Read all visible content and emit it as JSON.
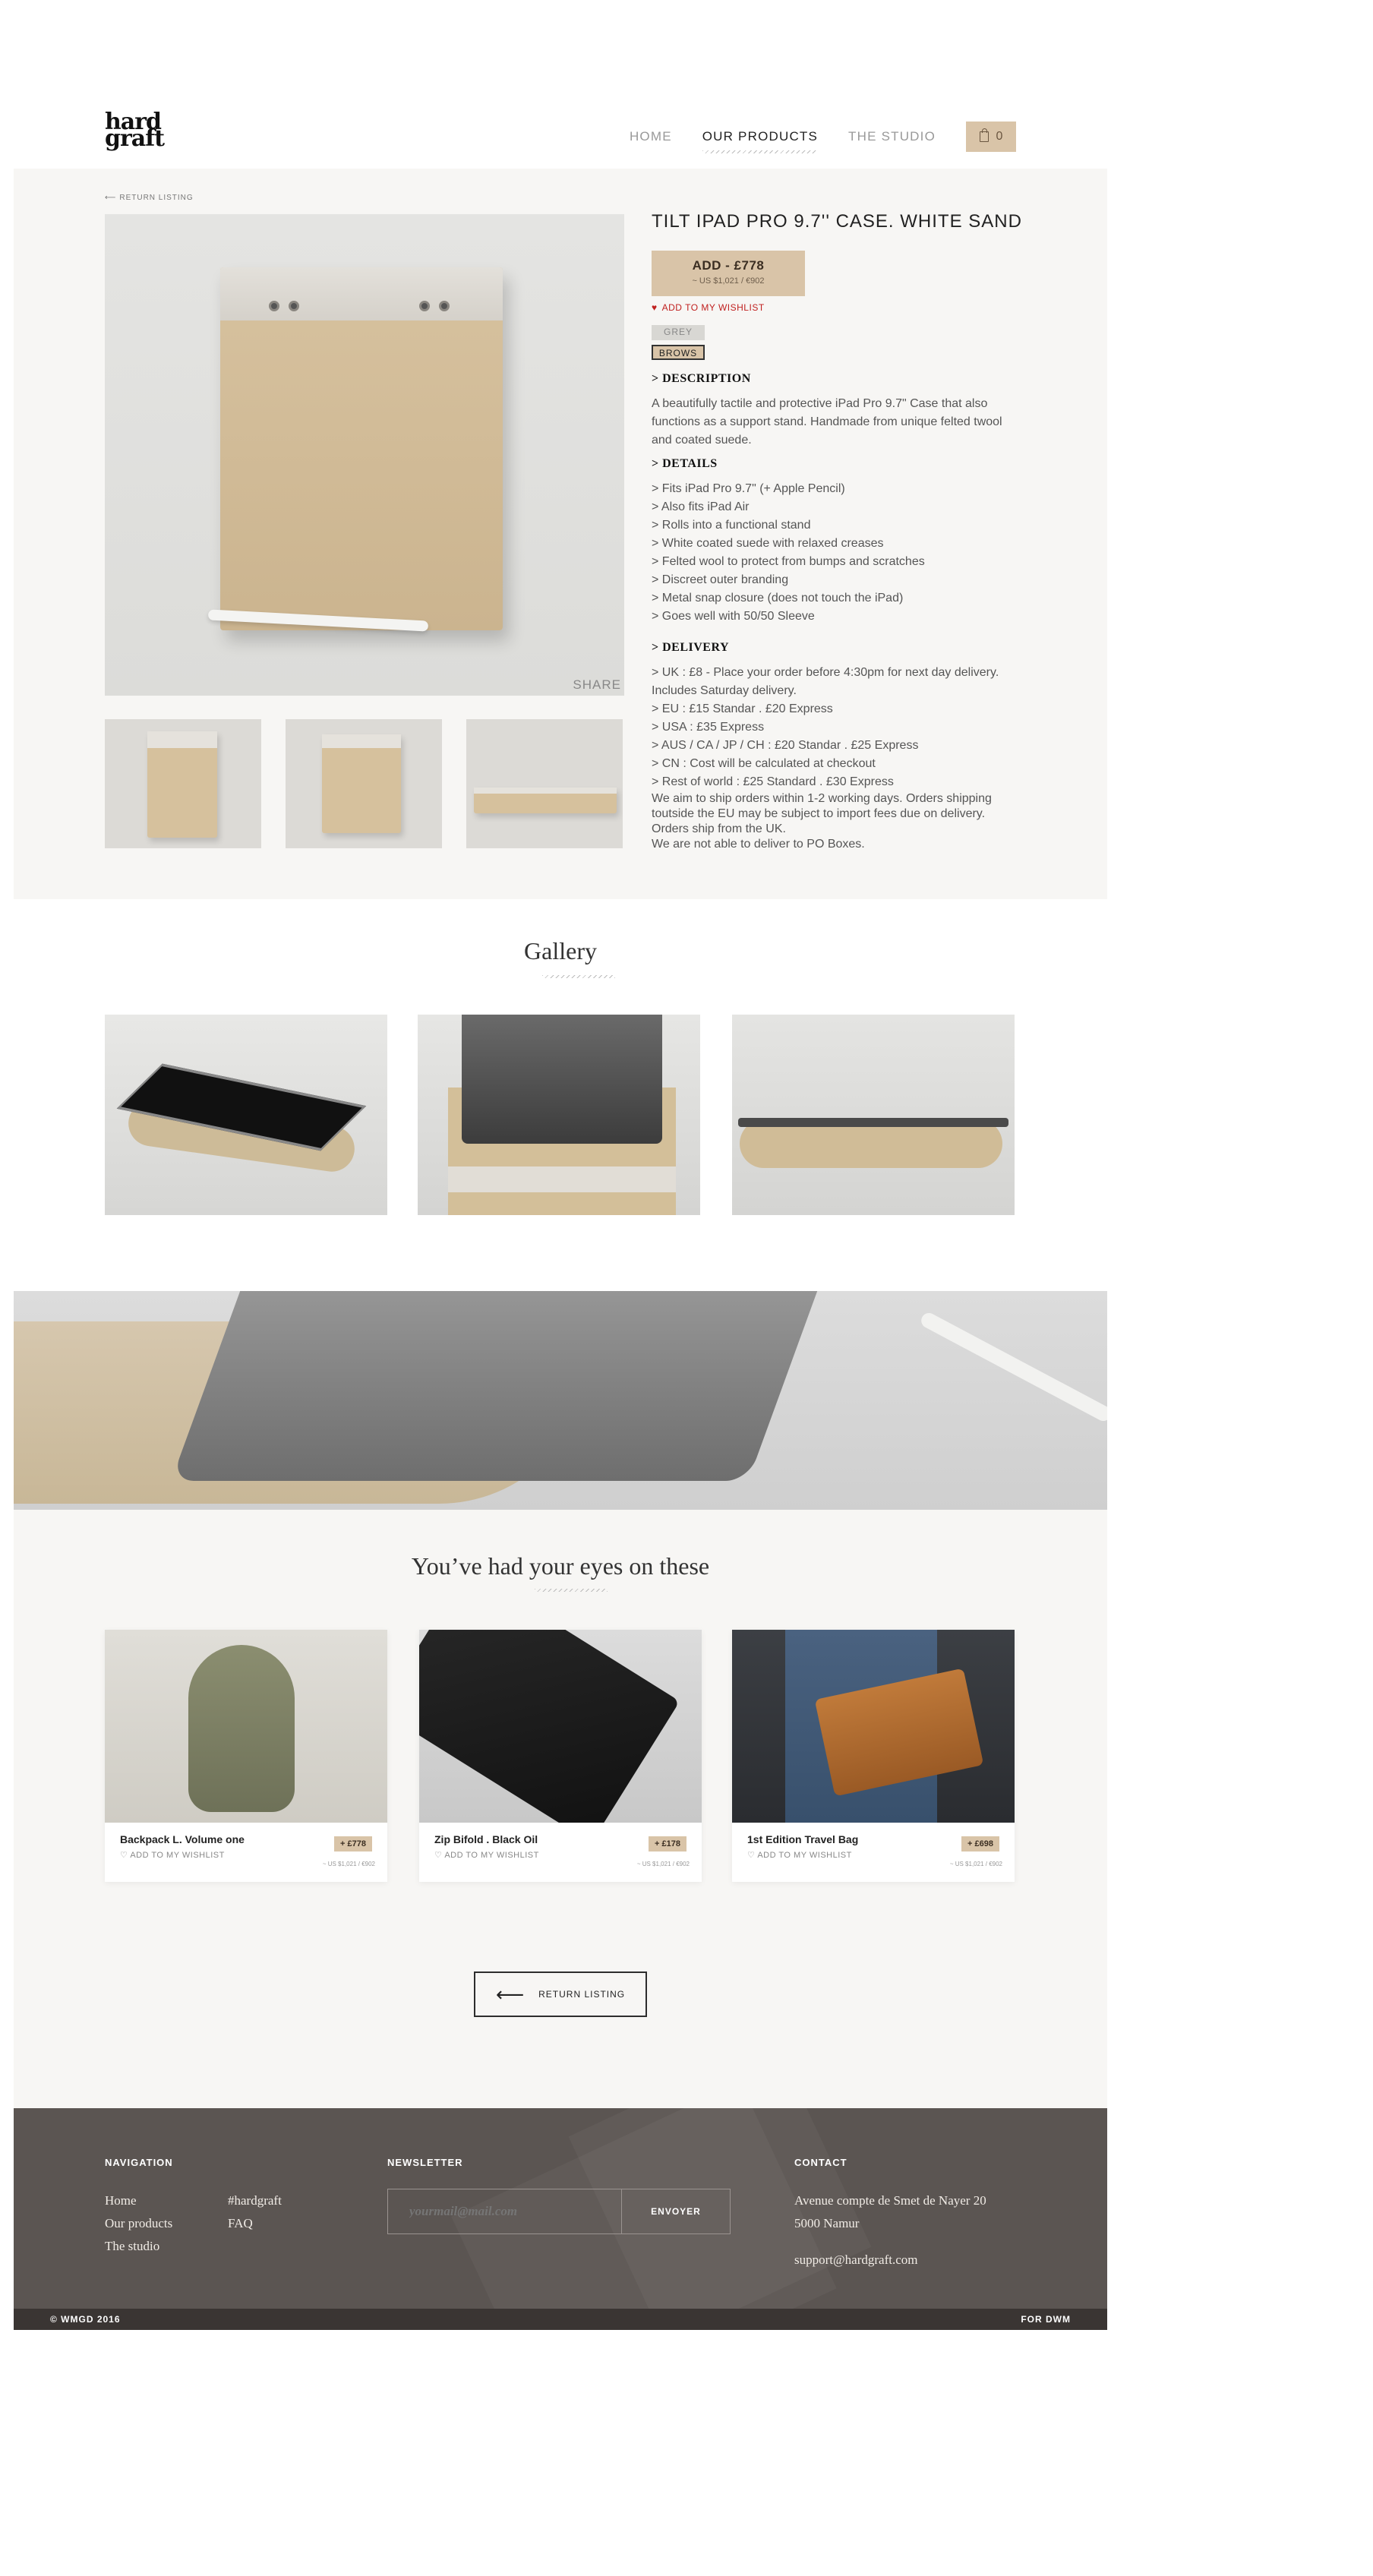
{
  "brand": {
    "logo_line1": "hard",
    "logo_line2": "graft"
  },
  "nav": {
    "items": [
      "HOME",
      "OUR PRODUCTS",
      "THE STUDIO"
    ],
    "active": "OUR PRODUCTS",
    "cart_count": "0"
  },
  "product": {
    "return_label": "RETURN LISTING",
    "title": "TILT IPAD PRO 9.7'' CASE. WHITE SAND",
    "add_label": "ADD - £778",
    "add_sub": "~ US $1,021 / €902",
    "wishlist": "ADD TO MY WISHLIST",
    "colors": [
      "GREY",
      "BROWS"
    ],
    "selected_color": "BROWS",
    "share": "SHARE",
    "description_heading": "> DESCRIPTION",
    "description": "A beautifully tactile and protective iPad Pro 9.7\" Case that also functions as a support stand. Handmade from unique felted twool and coated suede.",
    "details_heading": "> DETAILS",
    "details": [
      "> Fits iPad Pro 9.7\" (+ Apple Pencil)",
      "> Also fits iPad Air",
      "> Rolls into a functional stand",
      "> White coated suede with relaxed creases",
      "> Felted wool to protect from bumps and scratches",
      "> Discreet outer branding",
      "> Metal snap closure (does not touch the iPad)",
      "> Goes well with 50/50 Sleeve"
    ],
    "delivery_heading": "> DELIVERY",
    "delivery": [
      "> UK : £8  - Place your order before 4:30pm for next day delivery. Includes Saturday delivery.",
      "> EU : £15 Standar . £20 Express",
      "> USA : £35 Express",
      "> AUS / CA / JP / CH : £20 Standar . £25 Express",
      "> CN :  Cost will be calculated at checkout",
      "> Rest of world : £25 Standard . £30 Express",
      "We aim to ship orders within 1-2 working days. Orders shipping toutside the EU may be subject to import fees due on delivery. Orders ship from the UK.",
      "We are not able to deliver to PO Boxes."
    ]
  },
  "gallery": {
    "title": "Gallery"
  },
  "eyes": {
    "title": "You’ve had your eyes on these",
    "items": [
      {
        "name": "Backpack L. Volume one",
        "wishlist": "ADD TO MY WISHLIST",
        "price": "+ £778",
        "usd": "~ US $1,021 / €902"
      },
      {
        "name": "Zip Bifold . Black Oil",
        "wishlist": "ADD TO MY WISHLIST",
        "price": "+ £178",
        "usd": "~ US $1,021 / €902"
      },
      {
        "name": "1st Edition Travel Bag",
        "wishlist": "ADD TO MY WISHLIST",
        "price": "+ £698",
        "usd": "~ US $1,021 / €902"
      }
    ],
    "return_label": "RETURN LISTING"
  },
  "footer": {
    "navigation_heading": "NAVIGATION",
    "nav_links": [
      "Home",
      "Our products",
      "The studio",
      "#hardgraft",
      "FAQ"
    ],
    "newsletter_heading": "NEWSLETTER",
    "newsletter_placeholder": "yourmail@mail.com",
    "newsletter_button": "ENVOYER",
    "contact_heading": "CONTACT",
    "address_line1": "Avenue compte de Smet de Nayer 20",
    "address_line2": "5000 Namur",
    "email": "support@hardgraft.com",
    "copyright": "© WMGD 2016",
    "credit": "FOR DWM"
  },
  "colors": {
    "accent": "#d9c4a8",
    "footer_bg": "#5b5552",
    "wishlist_red": "#c0201f"
  }
}
